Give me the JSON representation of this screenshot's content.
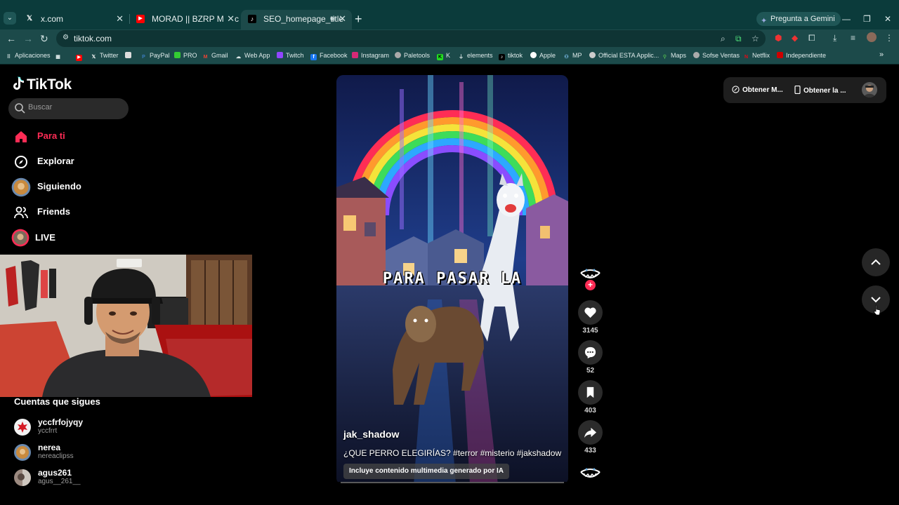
{
  "browser": {
    "tabs": [
      {
        "title": "x.com",
        "active": false
      },
      {
        "title": "MORAD || BZRP Music Sessions",
        "active": false
      },
      {
        "title": "SEO_homepage_title",
        "active": true
      }
    ],
    "gemini_label": "Pregunta a Gemini",
    "url": "tiktok.com",
    "bookmarks": [
      "Aplicaciones",
      "Twitter",
      "PayPal",
      "PRO",
      "Gmail",
      "Web App",
      "Twitch",
      "Facebook",
      "Instagram",
      "Paletools",
      "K",
      "elements",
      "tiktok",
      "Apple",
      "MP",
      "Official ESTA Applic...",
      "Maps",
      "Sofse Ventas",
      "Netflix",
      "Independiente"
    ]
  },
  "tiktok": {
    "logo": "TikTok",
    "search_placeholder": "Buscar",
    "nav": [
      {
        "label": "Para ti",
        "icon": "home-icon",
        "active": true
      },
      {
        "label": "Explorar",
        "icon": "compass-icon",
        "active": false
      },
      {
        "label": "Siguiendo",
        "icon": "following-avatar-icon",
        "active": false
      },
      {
        "label": "Friends",
        "icon": "friends-icon",
        "active": false
      },
      {
        "label": "LIVE",
        "icon": "live-icon",
        "active": false
      }
    ],
    "following_title": "Cuentas que sigues",
    "following": [
      {
        "name": "yccfrfojyqy",
        "handle": "yccfrrt"
      },
      {
        "name": "nerea",
        "handle": "nereaclipss"
      },
      {
        "name": "agus261",
        "handle": "agus__261__"
      }
    ],
    "video": {
      "overlay_text": "PARA PASAR LA",
      "author": "jak_shadow",
      "caption": "¿QUE PERRO ELEGIRÍAS? #terror #misterio #jakshadow",
      "ai_badge": "Incluye contenido multimedia generado por IA",
      "progress": 0.0
    },
    "actions": {
      "likes": "3145",
      "comments": "52",
      "saves": "403",
      "shares": "433"
    },
    "top_right": {
      "get_coins": "Obtener M...",
      "get_app": "Obtener la ..."
    }
  },
  "colors": {
    "accent": "#fe2c55",
    "chrome": "#1c4a4a"
  }
}
